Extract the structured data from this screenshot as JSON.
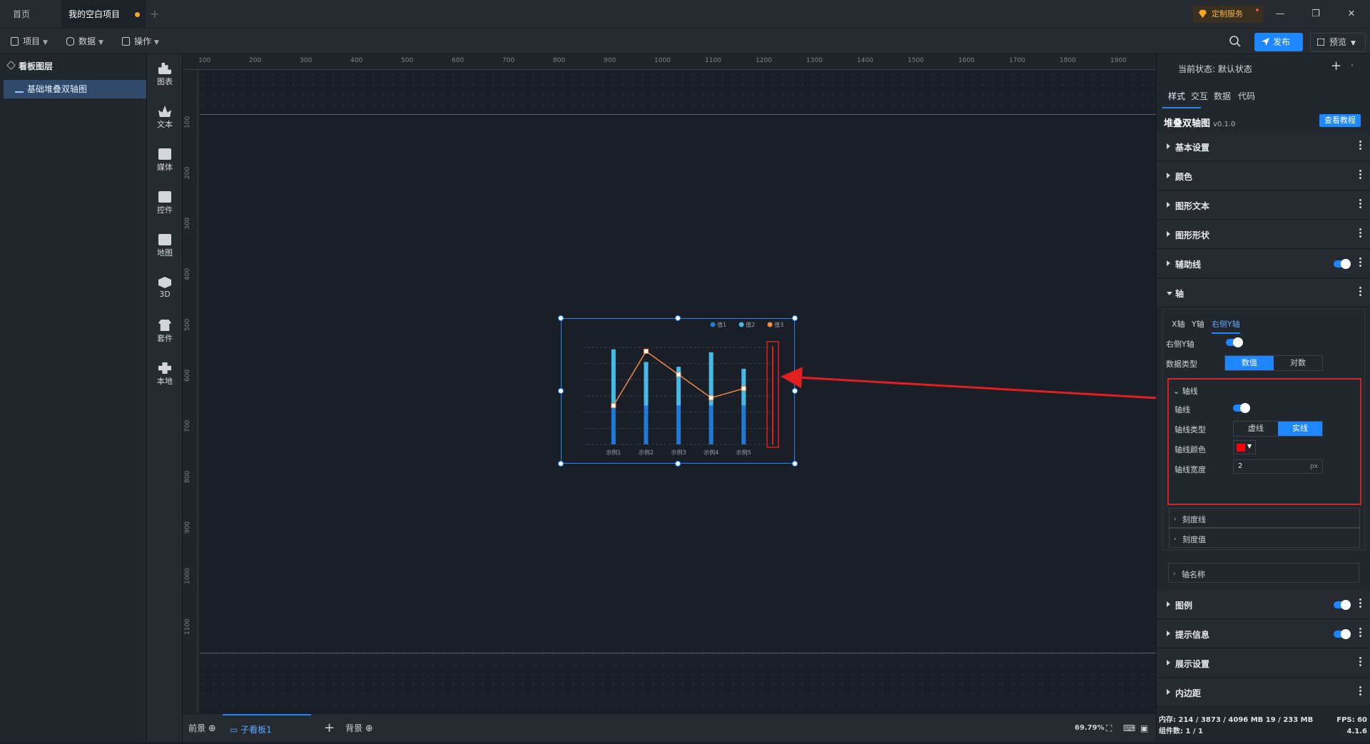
{
  "tabs": {
    "home": "首页",
    "project": "我的空白项目"
  },
  "custom_service": "定制服务",
  "toolbar": {
    "project": "项目",
    "data": "数据",
    "operate": "操作",
    "publish": "发布",
    "preview": "预览"
  },
  "layers": {
    "title": "看板图层",
    "item": "基础堆叠双轴图"
  },
  "components": [
    "图表",
    "文本",
    "媒体",
    "控件",
    "地图",
    "3D",
    "套件",
    "本地"
  ],
  "ruler": {
    "top": [
      "100",
      "200",
      "300",
      "400",
      "500",
      "600",
      "700",
      "800",
      "900",
      "1000",
      "1100",
      "1200",
      "1300",
      "1400",
      "1500",
      "1600",
      "1700",
      "1800",
      "1900"
    ],
    "left": [
      "100",
      "200",
      "300",
      "400",
      "500",
      "600",
      "700",
      "800",
      "900",
      "1000",
      "1100"
    ]
  },
  "chart_data": {
    "type": "bar",
    "categories": [
      "示例1",
      "示例2",
      "示例3",
      "示例4",
      "示例5"
    ],
    "legend": [
      "值1",
      "值2",
      "值3"
    ],
    "series": [
      {
        "name": "值1",
        "values": [
          40,
          40,
          40,
          40,
          40
        ]
      },
      {
        "name": "值2",
        "values": [
          58,
          45,
          40,
          55,
          38
        ]
      },
      {
        "name": "值3",
        "values": [
          25,
          60,
          45,
          30,
          36
        ]
      }
    ],
    "colors": [
      "#1f7ad6",
      "#46b9e8",
      "#f08a45"
    ]
  },
  "bottom": {
    "foreground": "前景",
    "subboard": "子看板1",
    "background": "背景",
    "zoom": "69.79%"
  },
  "props": {
    "state": "当前状态: 默认状态",
    "tabs": [
      "样式",
      "交互",
      "数据",
      "代码"
    ],
    "component_name": "堆叠双轴图",
    "version": "v0.1.0",
    "tutorial": "查看教程",
    "sections_top": [
      "基本设置",
      "颜色",
      "图形文本",
      "图形形状",
      "辅助线",
      "轴"
    ],
    "axis": {
      "tabs": [
        "X轴",
        "Y轴",
        "右侧Y轴"
      ],
      "right_y_label": "右侧Y轴",
      "data_type_label": "数据类型",
      "data_type_options": [
        "数值",
        "对数"
      ],
      "axisline_title": "轴线",
      "axisline_label": "轴线",
      "line_type_label": "轴线类型",
      "line_type_options": [
        "虚线",
        "实线"
      ],
      "line_color_label": "轴线颜色",
      "line_color": "#ff0000",
      "line_width_label": "轴线宽度",
      "line_width": "2",
      "line_width_unit": "px",
      "subsections": [
        "刻度线",
        "刻度值",
        "轴名称"
      ]
    },
    "sections_bottom": [
      "图例",
      "提示信息",
      "展示设置",
      "内边距"
    ]
  },
  "status": {
    "memory": "内存: 214 / 3873 / 4096 MB  19 / 233 MB",
    "components": "组件数: 1 / 1",
    "fps": "FPS: 60",
    "version": "4.1.6"
  }
}
